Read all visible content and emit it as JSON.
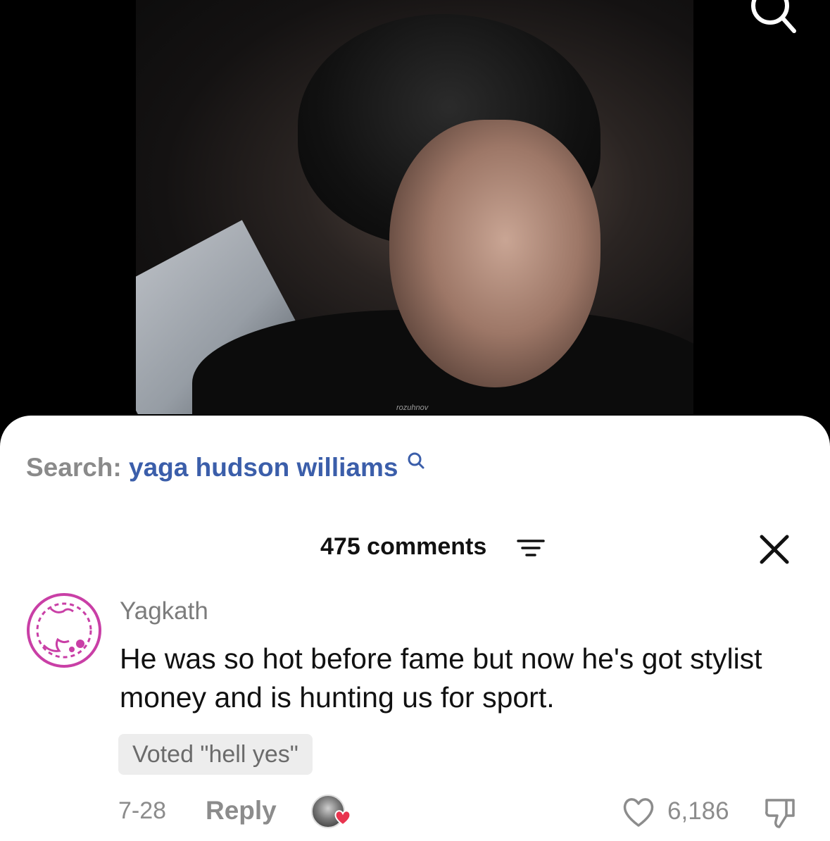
{
  "video": {
    "watermark": "rozuhnov"
  },
  "search_bar": {
    "prefix": "Search:",
    "query": "yaga hudson williams"
  },
  "comments_header": {
    "count_label": "475 comments"
  },
  "comment": {
    "username": "Yagkath",
    "text": "He was so hot before fame but now he's got stylist money and is hunting us for sport.",
    "vote_badge": "Voted \"hell yes\"",
    "date": "7-28",
    "reply_label": "Reply",
    "like_count": "6,186"
  },
  "colors": {
    "search_query": "#3b5eaa",
    "avatar_ring": "#c93fa6",
    "creator_heart": "#e8344f"
  },
  "icons": [
    "search-icon",
    "sort-icon",
    "close-icon",
    "heart-icon",
    "dislike-icon"
  ]
}
